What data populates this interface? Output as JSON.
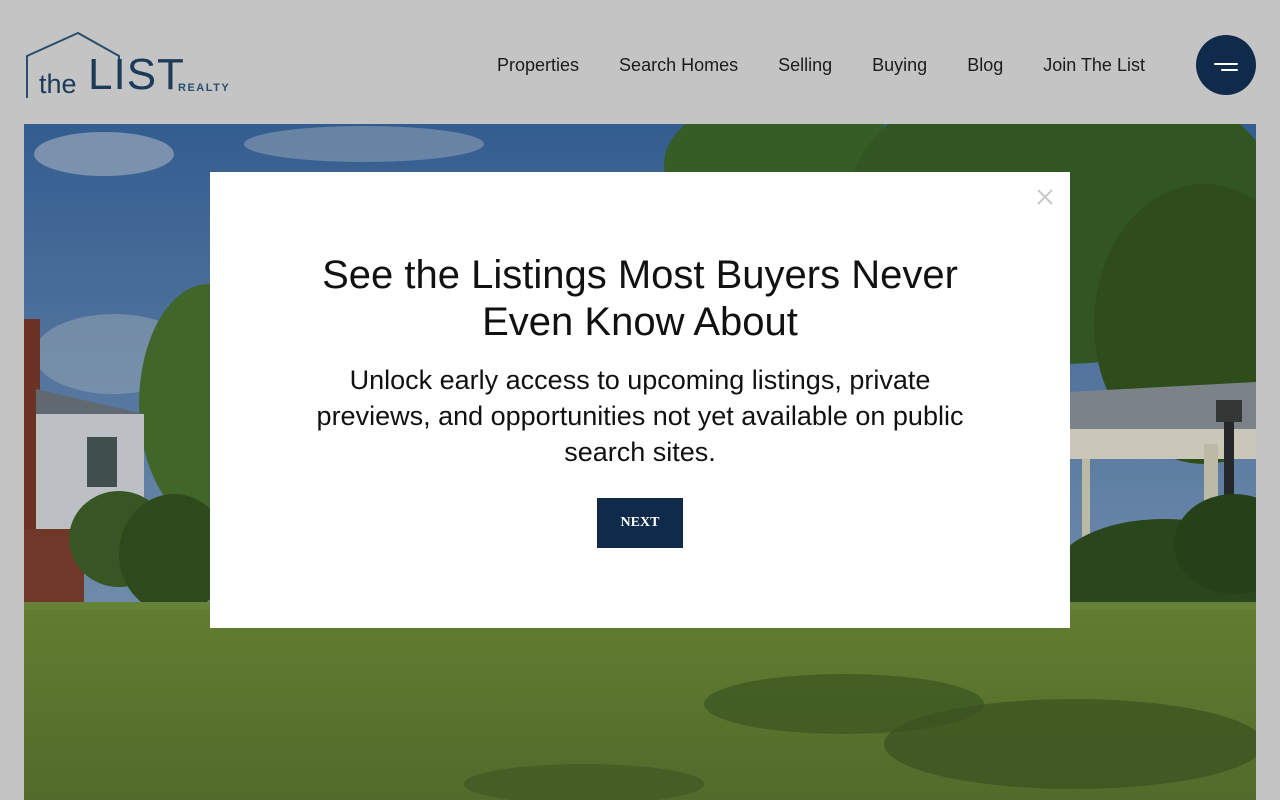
{
  "brand": {
    "logo_the": "the",
    "logo_list": "LIST",
    "logo_realty": "REALTY",
    "color_navy": "#0f2a4a"
  },
  "nav": {
    "items": [
      {
        "label": "Properties"
      },
      {
        "label": "Search Homes"
      },
      {
        "label": "Selling"
      },
      {
        "label": "Buying"
      },
      {
        "label": "Blog"
      },
      {
        "label": "Join The List"
      }
    ],
    "menu_icon": "hamburger-menu-icon"
  },
  "hero": {
    "image": "house-lawn-photo"
  },
  "modal": {
    "title": "See the Listings Most Buyers Never Even Know About",
    "body": "Unlock early access to upcoming listings, private previews, and opportunities not yet available on public search sites.",
    "next_label": "NEXT",
    "close_icon": "close-icon"
  }
}
